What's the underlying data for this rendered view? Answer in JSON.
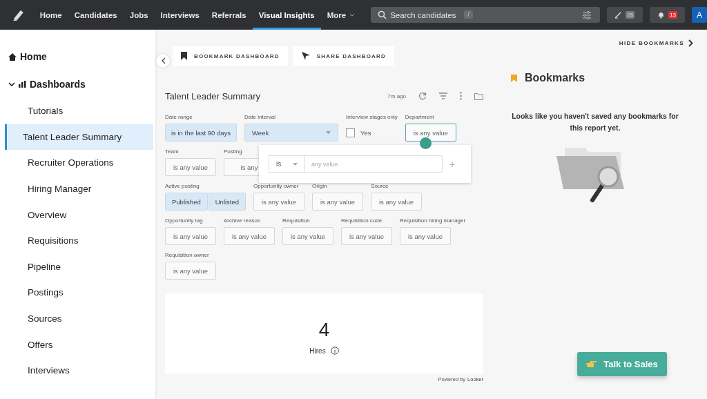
{
  "nav": {
    "items": [
      {
        "label": "Home",
        "selected": false
      },
      {
        "label": "Candidates",
        "selected": false
      },
      {
        "label": "Jobs",
        "selected": false
      },
      {
        "label": "Interviews",
        "selected": false
      },
      {
        "label": "Referrals",
        "selected": false
      },
      {
        "label": "Visual Insights",
        "selected": true
      }
    ],
    "more": "More"
  },
  "search": {
    "placeholder": "Search candidates",
    "shortcut": "/"
  },
  "badges": [
    {
      "kind": "edit",
      "count": "26"
    },
    {
      "kind": "bell",
      "count": "13"
    }
  ],
  "avatar": "A",
  "sidebar": {
    "items": [
      {
        "label": "Home",
        "kind": "home"
      },
      {
        "label": "Dashboards",
        "kind": "section",
        "expanded": true,
        "children": [
          {
            "label": "Tutorials",
            "selected": false
          },
          {
            "label": "Talent Leader Summary",
            "selected": true
          },
          {
            "label": "Recruiter Operations",
            "selected": false
          },
          {
            "label": "Hiring Manager",
            "selected": false
          },
          {
            "label": "Overview",
            "selected": false
          },
          {
            "label": "Requisitions",
            "selected": false
          },
          {
            "label": "Pipeline",
            "selected": false
          },
          {
            "label": "Postings",
            "selected": false
          },
          {
            "label": "Sources",
            "selected": false
          },
          {
            "label": "Offers",
            "selected": false
          },
          {
            "label": "Interviews",
            "selected": false
          }
        ]
      }
    ]
  },
  "actions": [
    {
      "label": "BOOKMARK DASHBOARD",
      "kind": "bookmark"
    },
    {
      "label": "SHARE DASHBOARD",
      "kind": "share"
    }
  ],
  "hide_bookmarks": "HIDE BOOKMARKS",
  "dashboard": {
    "title": "Talent Leader Summary",
    "updated": "7m ago",
    "filter_rows": [
      [
        {
          "label": "Date range",
          "kind": "chip",
          "value": "is in the last 90 days",
          "active": true
        },
        {
          "label": "Date interval",
          "kind": "select",
          "value": "Week",
          "active": true
        },
        {
          "label": "Interview stages only",
          "kind": "checkbox",
          "value": "Yes",
          "checked": false
        },
        {
          "label": "Department",
          "kind": "chip",
          "value": "is any value",
          "active": false,
          "focused": true
        }
      ],
      [
        {
          "label": "Team",
          "kind": "chip",
          "value": "is any value",
          "active": false
        },
        {
          "label": "Posting",
          "kind": "chip",
          "value": "is any",
          "active": false
        }
      ],
      [
        {
          "label": "Active posting",
          "kind": "toggle",
          "options": [
            {
              "label": "Published",
              "selected": true
            },
            {
              "label": "Unlisted",
              "selected": true
            }
          ]
        },
        {
          "label": "Opportunity owner",
          "kind": "chip",
          "value": "is any value",
          "active": false
        },
        {
          "label": "Origin",
          "kind": "chip",
          "value": "is any value",
          "active": false
        },
        {
          "label": "Source",
          "kind": "chip",
          "value": "is any value",
          "active": false
        }
      ],
      [
        {
          "label": "Opportunity tag",
          "kind": "chip",
          "value": "is any value",
          "active": false
        },
        {
          "label": "Archive reason",
          "kind": "chip",
          "value": "is any value",
          "active": false
        },
        {
          "label": "Requisition",
          "kind": "chip",
          "value": "is any value",
          "active": false
        },
        {
          "label": "Requisition code",
          "kind": "chip",
          "value": "is any value",
          "active": false
        },
        {
          "label": "Requisition hiring manager",
          "kind": "chip",
          "value": "is any value",
          "active": false
        }
      ],
      [
        {
          "label": "Requisition owner",
          "kind": "chip",
          "value": "is any value",
          "active": false
        }
      ]
    ],
    "popover": {
      "operator": "is",
      "placeholder": "any value",
      "add": "+"
    },
    "tile": {
      "value": "4",
      "label": "Hires"
    },
    "powered_by": "Powered by",
    "brand": "Looker"
  },
  "bookmarks": {
    "title": "Bookmarks",
    "message": "Looks like you haven't saved any bookmarks for this report yet."
  },
  "cta": {
    "label": "Talk to Sales"
  }
}
